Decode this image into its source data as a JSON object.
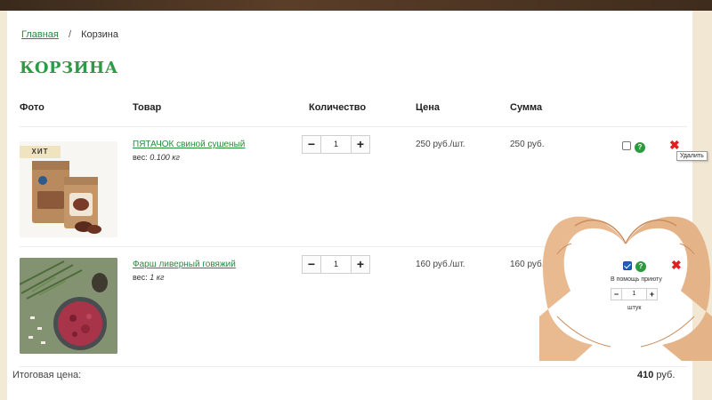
{
  "breadcrumb": {
    "home": "Главная",
    "separator": "/",
    "current": "Корзина"
  },
  "page_title": "КОРЗИНА",
  "table": {
    "headers": {
      "photo": "Фото",
      "product": "Товар",
      "quantity": "Количество",
      "price": "Цена",
      "sum": "Сумма"
    }
  },
  "items": [
    {
      "badge": "ХИТ",
      "name": "ПЯТАЧОК свиной сушеный",
      "weight_label": "вес:",
      "weight_value": "0.100 кг",
      "qty_minus": "−",
      "qty": "1",
      "qty_plus": "+",
      "price": "250 руб./шт.",
      "sum": "250 руб.",
      "help": "?",
      "delete": "✖",
      "delete_tooltip": "Удалить",
      "checked": false
    },
    {
      "name": "Фарш ливерный говяжий",
      "weight_label": "вес:",
      "weight_value": "1 кг",
      "qty_minus": "−",
      "qty": "1",
      "qty_plus": "+",
      "price": "160 руб./шт.",
      "sum": "160 руб.",
      "help": "?",
      "delete": "✖",
      "checked": true,
      "promo_label": "В помощь приюту",
      "promo_qty": "1",
      "promo_unit": "штук"
    }
  ],
  "total": {
    "label": "Итоговая цена:",
    "value": "410",
    "currency": "руб."
  },
  "colors": {
    "accent_green": "#2e9a45",
    "link_green": "#2a8a3e",
    "delete_red": "#e02020",
    "top_bar": "#3a2a1c"
  }
}
